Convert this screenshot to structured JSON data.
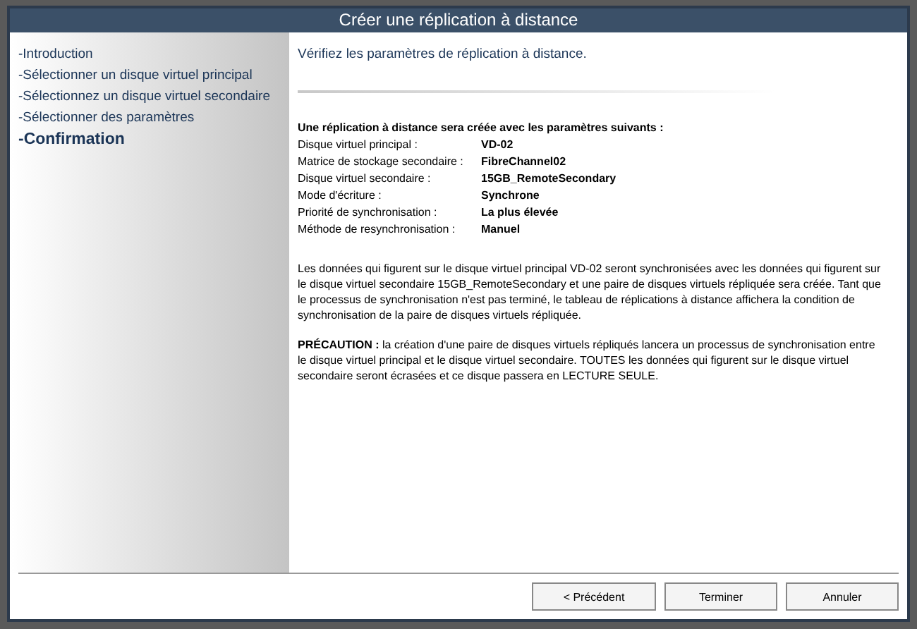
{
  "window": {
    "title": "Créer une réplication à distance"
  },
  "steps": [
    {
      "label": "-Introduction",
      "selected": false
    },
    {
      "label": "-Sélectionner un disque virtuel principal",
      "selected": false
    },
    {
      "label": "-Sélectionnez un disque virtuel secondaire",
      "selected": false
    },
    {
      "label": "-Sélectionner des paramètres",
      "selected": false
    },
    {
      "label": "-Confirmation",
      "selected": true
    }
  ],
  "instruction": "Vérifiez les paramètres de réplication à distance.",
  "summary": {
    "heading": "Une réplication à distance sera créée avec les paramètres suivants :",
    "rows": [
      {
        "label": "Disque virtuel principal :",
        "value": "VD-02"
      },
      {
        "label": "Matrice de stockage secondaire :",
        "value": "FibreChannel02"
      },
      {
        "label": "Disque virtuel secondaire :",
        "value": "15GB_RemoteSecondary"
      },
      {
        "label": "Mode d'écriture :",
        "value": "Synchrone"
      },
      {
        "label": "Priorité de synchronisation :",
        "value": "La plus élevée"
      },
      {
        "label": "Méthode de resynchronisation :",
        "value": "Manuel"
      }
    ]
  },
  "paragraphs": [
    "Les données qui figurent sur le disque virtuel principal VD-02 seront synchronisées avec les données qui figurent sur le disque virtuel secondaire 15GB_RemoteSecondary et une paire de disques virtuels répliquée sera créée. Tant que le processus de synchronisation n'est pas terminé, le tableau de réplications à distance affichera la condition de synchronisation de la paire de disques virtuels répliquée.",
    "**PRÉCAUTION :** la création d'une paire de disques virtuels répliqués lancera un processus de synchronisation entre le disque virtuel principal et le disque virtuel secondaire. TOUTES les données qui figurent sur le disque virtuel secondaire seront écrasées et ce disque passera en LECTURE SEULE."
  ],
  "buttons": [
    "< Précédent",
    "Terminer",
    "Annuler"
  ]
}
